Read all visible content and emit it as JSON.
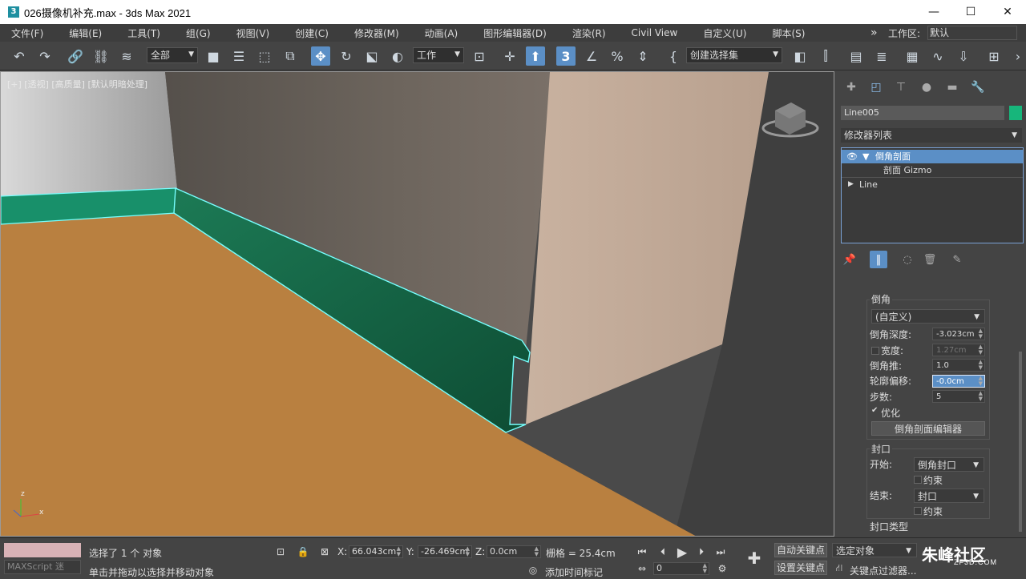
{
  "window": {
    "title": "026摄像机补充.max - 3ds Max 2021",
    "icon": "3",
    "minimize": "—",
    "maximize": "☐",
    "close": "✕"
  },
  "menu": [
    "文件(F)",
    "编辑(E)",
    "工具(T)",
    "组(G)",
    "视图(V)",
    "创建(C)",
    "修改器(M)",
    "动画(A)",
    "图形编辑器(D)",
    "渲染(R)",
    "Civil View",
    "自定义(U)",
    "脚本(S)"
  ],
  "menu_right": {
    "more": "»",
    "workspace_label": "工作区:",
    "workspace_value": "默认"
  },
  "toolbar": {
    "filter": "全部",
    "coord_system": "工作",
    "selection_set": "创建选择集",
    "snap_value": "3"
  },
  "viewport": {
    "label": "[+] [透视] [高质量] [默认明暗处理]",
    "axis_z": "z",
    "axis_x": "x"
  },
  "panel": {
    "object_name": "Line005",
    "object_color": "#17b67b",
    "modifier_list": "修改器列表",
    "stack": {
      "item1": "倒角剖面",
      "item2": "剖面 Gizmo",
      "item3": "Line"
    },
    "bevel": {
      "group": "倒角",
      "preset": "(自定义)",
      "depth_label": "倒角深度:",
      "depth_value": "-3.023cm",
      "width_label": "宽度:",
      "width_value": "1.27cm",
      "push_label": "倒角推:",
      "push_value": "1.0",
      "offset_label": "轮廓偏移:",
      "offset_value": "-0.0cm",
      "steps_label": "步数:",
      "steps_value": "5",
      "optimize_label": "优化",
      "editor_button": "倒角剖面编辑器"
    },
    "cap": {
      "group": "封口",
      "start_label": "开始:",
      "start_value": "倒角封口",
      "constrain1": "约束",
      "end_label": "结束:",
      "end_value": "封口",
      "constrain2": "约束",
      "cap_type": "封口类型"
    }
  },
  "status": {
    "maxscript": "MAXScript 迷",
    "selected": "选择了 1 个 对象",
    "prompt": "单击并拖动以选择并移动对象",
    "x_label": "X:",
    "x_value": "66.043cm",
    "y_label": "Y:",
    "y_value": "-26.469cm",
    "z_label": "Z:",
    "z_value": "0.0cm",
    "grid": "栅格 = 25.4cm",
    "add_time_tag": "添加时间标记",
    "frame": "0",
    "auto_key": "自动关键点",
    "set_key": "设置关键点",
    "selected_object": "选定对象",
    "key_filters": "关键点过滤器..."
  },
  "watermark": {
    "brand": "朱峰社区",
    "url": "ZF3D.COM"
  }
}
